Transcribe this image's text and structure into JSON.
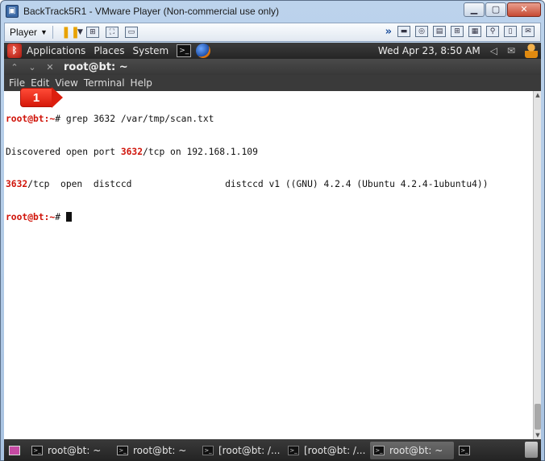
{
  "window": {
    "title": "BackTrack5R1 - VMware Player (Non-commercial use only)",
    "app_icon": "vmware-icon",
    "controls": [
      "minimize",
      "maximize",
      "close"
    ]
  },
  "vmware_toolbar": {
    "player_label": "Player",
    "icons": [
      "pause-icon",
      "network-icon",
      "fullscreen-icon",
      "unity-icon"
    ],
    "right_icons": [
      "harddisk-icon",
      "cdrom-icon",
      "floppy-icon",
      "network-adapter-icon",
      "printer-icon",
      "usb-icon",
      "sound-icon",
      "message-icon"
    ]
  },
  "gnome_panel": {
    "menus": [
      "Applications",
      "Places",
      "System"
    ],
    "clock": "Wed Apr 23,  8:50 AM"
  },
  "terminal": {
    "window_title": "root@bt: ~",
    "menu": [
      "File",
      "Edit",
      "View",
      "Terminal",
      "Help"
    ],
    "lines": [
      {
        "prompt": "root@bt:~",
        "command": "# grep 3632 /var/tmp/scan.txt"
      },
      {
        "pre": "Discovered open port ",
        "highlight": "3632",
        "post": "/tcp on 192.168.1.109"
      },
      {
        "pre": "",
        "highlight": "3632",
        "post": "/tcp  open  distccd                 distccd v1 ((GNU) 4.2.4 (Ubuntu 4.2.4-1ubuntu4))"
      },
      {
        "prompt": "root@bt:~",
        "command": "# "
      }
    ]
  },
  "annotation": {
    "label": "1",
    "color": "#e0200f"
  },
  "taskbar": {
    "tasks": [
      {
        "label": "root@bt: ~",
        "active": false
      },
      {
        "label": "root@bt: ~",
        "active": false
      },
      {
        "label": "[root@bt: /...",
        "active": false
      },
      {
        "label": "[root@bt: /...",
        "active": false
      },
      {
        "label": "root@bt: ~",
        "active": true
      }
    ]
  },
  "colors": {
    "accent_red": "#d0140a",
    "panel": "#2e2e2e",
    "vm_frame": "#bcd3ec"
  }
}
